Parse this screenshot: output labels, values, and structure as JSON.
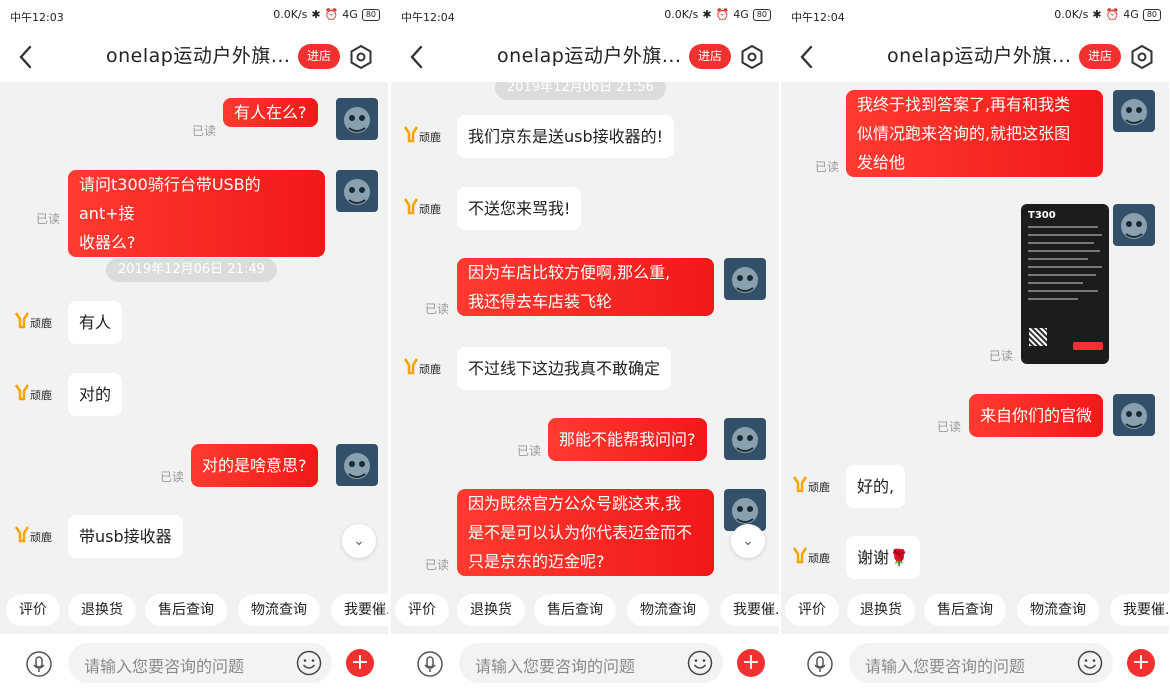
{
  "colors": {
    "accent": "#f23030",
    "bubble_right": "#ff3b30",
    "bubble_left": "#ffffff",
    "background": "#f2f2f2",
    "read": "#999999"
  },
  "panels": [
    {
      "status": {
        "time": "中午12:03",
        "speed": "0.0K/s",
        "signal": "4G",
        "battery": "80"
      },
      "header": {
        "title": "onelap运动户外旗...",
        "enter_shop": "进店"
      },
      "messages": [
        {
          "side": "right",
          "text": "有人在么?",
          "read": "已读"
        },
        {
          "side": "right",
          "text": "请问t300骑行台带USB的ant+接\n收器么?",
          "read": "已读"
        },
        {
          "type": "timestamp",
          "text": "2019年12月06日  21:49"
        },
        {
          "side": "left",
          "text": "有人",
          "logo": "顽鹿"
        },
        {
          "side": "left",
          "text": "对的",
          "logo": "顽鹿"
        },
        {
          "side": "right",
          "text": "对的是啥意思?",
          "read": "已读"
        },
        {
          "side": "left",
          "text": "带usb接收器",
          "logo": "顽鹿"
        }
      ],
      "quick_replies": [
        "评价",
        "退换货",
        "售后查询",
        "物流查询",
        "我要催..."
      ],
      "input": {
        "placeholder": "请输入您要咨询的问题"
      }
    },
    {
      "status": {
        "time": "中午12:04",
        "speed": "0.0K/s",
        "signal": "4G",
        "battery": "80"
      },
      "header": {
        "title": "onelap运动户外旗...",
        "enter_shop": "进店"
      },
      "messages": [
        {
          "type": "timestamp",
          "text": "2019年12月06日  21:56"
        },
        {
          "side": "left",
          "text": "我们京东是送usb接收器的!",
          "logo": "顽鹿"
        },
        {
          "side": "left",
          "text": "不送您来骂我!",
          "logo": "顽鹿"
        },
        {
          "side": "right",
          "text": "因为车店比较方便啊,那么重,\n我还得去车店装飞轮",
          "read": "已读"
        },
        {
          "side": "left",
          "text": "不过线下这边我真不敢确定",
          "logo": "顽鹿"
        },
        {
          "side": "right",
          "text": "那能不能帮我问问?",
          "read": "已读"
        },
        {
          "side": "right",
          "text": "因为既然官方公众号跳这来,我\n是不是可以认为你代表迈金而不\n只是京东的迈金呢?",
          "read": "已读"
        }
      ],
      "quick_replies": [
        "评价",
        "退换货",
        "售后查询",
        "物流查询",
        "我要催..."
      ],
      "input": {
        "placeholder": "请输入您要咨询的问题"
      }
    },
    {
      "status": {
        "time": "中午12:04",
        "speed": "0.0K/s",
        "signal": "4G",
        "battery": "80"
      },
      "header": {
        "title": "onelap运动户外旗...",
        "enter_shop": "进店"
      },
      "messages": [
        {
          "side": "right",
          "text": "我终于找到答案了,再有和我类\n似情况跑来咨询的,就把这张图\n发给他",
          "read": "已读"
        },
        {
          "side": "right",
          "type": "image",
          "image_title": "T300",
          "read": "已读"
        },
        {
          "side": "right",
          "text": "来自你们的官微",
          "read": "已读"
        },
        {
          "side": "left",
          "text": "好的,",
          "logo": "顽鹿"
        },
        {
          "side": "left",
          "text": "谢谢🌹",
          "logo": "顽鹿"
        }
      ],
      "quick_replies": [
        "评价",
        "退换货",
        "售后查询",
        "物流查询",
        "我要催..."
      ],
      "input": {
        "placeholder": "请输入您要咨询的问题"
      }
    }
  ]
}
